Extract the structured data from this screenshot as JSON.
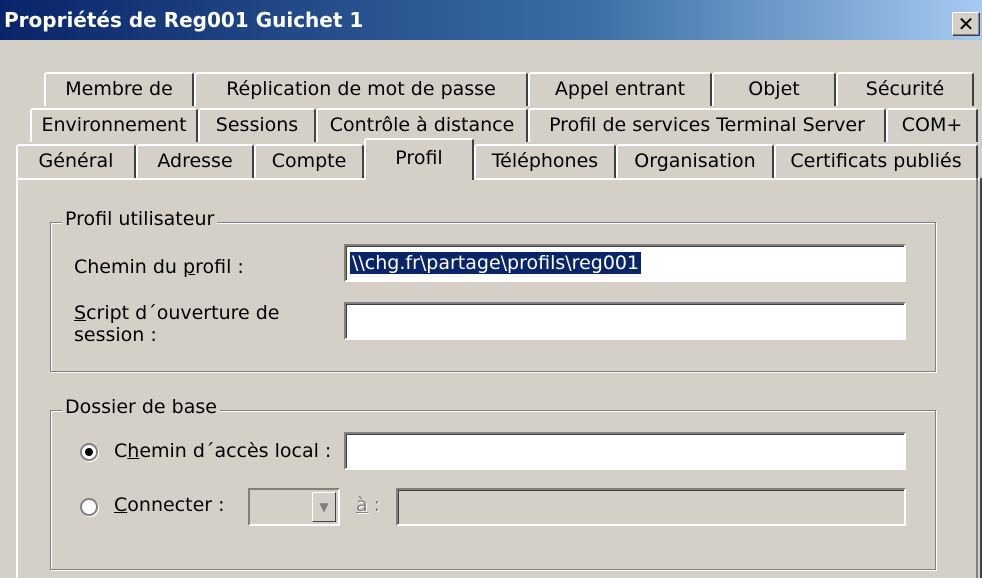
{
  "window": {
    "title": "Propriétés de Reg001 Guichet 1",
    "close_glyph": "✕"
  },
  "tabs": {
    "row1": [
      "Membre de",
      "Réplication de mot de passe",
      "Appel entrant",
      "Objet",
      "Sécurité"
    ],
    "row2": [
      "Environnement",
      "Sessions",
      "Contrôle à distance",
      "Profil de services Terminal Server",
      "COM+"
    ],
    "row3": [
      "Général",
      "Adresse",
      "Compte",
      "Profil",
      "Téléphones",
      "Organisation",
      "Certificats publiés"
    ],
    "active": "Profil"
  },
  "profil_utilisateur": {
    "legend": "Profil utilisateur",
    "chemin_label_pre": "Chemin du ",
    "chemin_label_u": "p",
    "chemin_label_post": "rofil :",
    "chemin_value": "\\\\chg.fr\\partage\\profils\\reg001",
    "script_label_u": "S",
    "script_label_line1_rest": "cript d´ouverture de",
    "script_label_line2": "session :",
    "script_value": ""
  },
  "dossier_de_base": {
    "legend": "Dossier de base",
    "local_label_pre": "C",
    "local_label_u": "h",
    "local_label_post": "emin d´accès local :",
    "local_value": "",
    "local_selected": true,
    "connecter_label_u": "C",
    "connecter_label_post": "onnecter :",
    "drive_value": "",
    "a_label_u": "à",
    "a_label_post": " :",
    "a_value": "",
    "dropdown_arrow": "▼"
  }
}
